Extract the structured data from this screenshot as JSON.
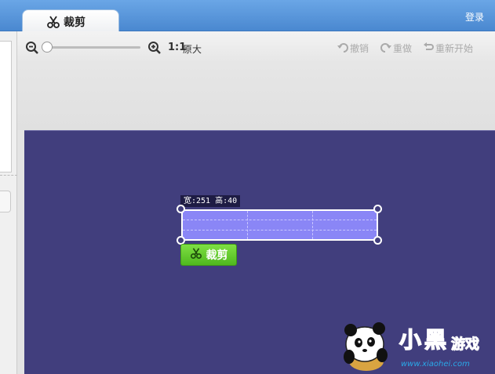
{
  "tab": {
    "label": "裁剪",
    "icon": "scissors-icon"
  },
  "header": {
    "login": "登录"
  },
  "toolbar": {
    "ratio": "1:1",
    "original_size": "原大",
    "undo": "撤销",
    "redo": "重做",
    "restart": "重新开始",
    "zoom": 0
  },
  "crop": {
    "size_label": "宽:251 高:40",
    "button": "裁剪"
  },
  "watermark": {
    "brand": "小黑游戏",
    "url": "www.xiaohei.com"
  },
  "colors": {
    "tab_bar": "#4a88d0",
    "canvas": "#413e7d",
    "crop_fill": "#8a86f6",
    "crop_button": "#5cc428"
  }
}
